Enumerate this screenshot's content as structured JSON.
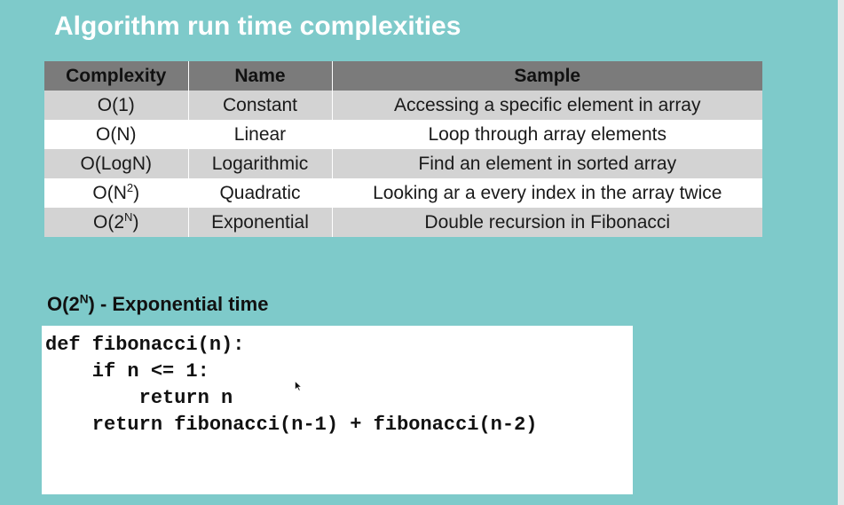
{
  "slide": {
    "title": "Algorithm run time complexities"
  },
  "table": {
    "headers": [
      "Complexity",
      "Name",
      "Sample"
    ],
    "rows": [
      {
        "complexity_base": "O(1)",
        "complexity_sup": "",
        "complexity_close": "",
        "name": "Constant",
        "sample": "Accessing a specific element in array"
      },
      {
        "complexity_base": "O(N)",
        "complexity_sup": "",
        "complexity_close": "",
        "name": "Linear",
        "sample": "Loop through array elements"
      },
      {
        "complexity_base": "O(LogN)",
        "complexity_sup": "",
        "complexity_close": "",
        "name": "Logarithmic",
        "sample": "Find an element in sorted array"
      },
      {
        "complexity_base": "O(N",
        "complexity_sup": "2",
        "complexity_close": ")",
        "name": "Quadratic",
        "sample": "Looking ar a every index in the array twice"
      },
      {
        "complexity_base": "O(2",
        "complexity_sup": "N",
        "complexity_close": ")",
        "name": "Exponential",
        "sample": "Double recursion in Fibonacci"
      }
    ]
  },
  "section": {
    "heading_prefix": "O(2",
    "heading_sup": "N",
    "heading_suffix": ") - Exponential time"
  },
  "code": {
    "lines": [
      "def fibonacci(n):",
      "    if n <= 1:",
      "        return n",
      "    return fibonacci(n-1) + fibonacci(n-2)"
    ]
  },
  "colors": {
    "background": "#7ecaca",
    "header_row": "#7b7b7b",
    "odd_row": "#d3d3d3",
    "even_row": "#ffffff",
    "title_text": "#ffffff"
  },
  "icons": {
    "cursor": "mouse-pointer-icon"
  }
}
